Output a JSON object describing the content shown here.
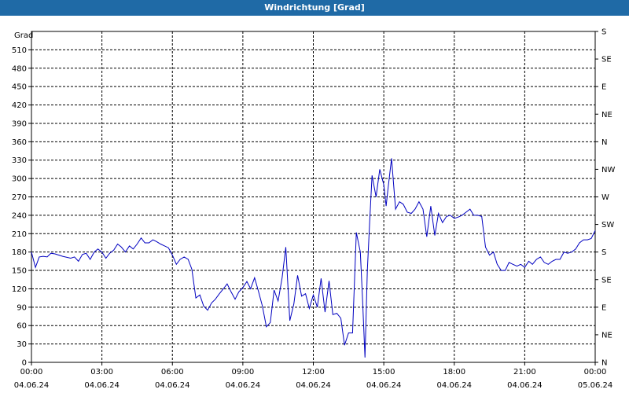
{
  "window": {
    "title": "Windrichtung [Grad]"
  },
  "chart_data": {
    "type": "line",
    "title": "Windrichtung [Grad]",
    "ylabel": "Grad",
    "xlabel": "",
    "ylim": [
      0,
      540
    ],
    "xlim_hours": [
      0,
      24
    ],
    "grid": true,
    "y_ticks": [
      0,
      30,
      60,
      90,
      120,
      150,
      180,
      210,
      240,
      270,
      300,
      330,
      360,
      390,
      420,
      450,
      480,
      510
    ],
    "right_axis_labels": [
      {
        "value": 0,
        "label": "N"
      },
      {
        "value": 45,
        "label": "NE"
      },
      {
        "value": 90,
        "label": "E"
      },
      {
        "value": 135,
        "label": "SE"
      },
      {
        "value": 180,
        "label": "S"
      },
      {
        "value": 225,
        "label": "SW"
      },
      {
        "value": 270,
        "label": "W"
      },
      {
        "value": 315,
        "label": "NW"
      },
      {
        "value": 360,
        "label": "N"
      },
      {
        "value": 405,
        "label": "NE"
      },
      {
        "value": 450,
        "label": "E"
      },
      {
        "value": 495,
        "label": "SE"
      },
      {
        "value": 540,
        "label": "S"
      }
    ],
    "x_ticks": [
      {
        "hour": 0,
        "time": "00:00",
        "date": "04.06.24"
      },
      {
        "hour": 3,
        "time": "03:00",
        "date": "04.06.24"
      },
      {
        "hour": 6,
        "time": "06:00",
        "date": "04.06.24"
      },
      {
        "hour": 9,
        "time": "09:00",
        "date": "04.06.24"
      },
      {
        "hour": 12,
        "time": "12:00",
        "date": "04.06.24"
      },
      {
        "hour": 15,
        "time": "15:00",
        "date": "04.06.24"
      },
      {
        "hour": 18,
        "time": "18:00",
        "date": "04.06.24"
      },
      {
        "hour": 21,
        "time": "21:00",
        "date": "04.06.24"
      },
      {
        "hour": 24,
        "time": "00:00",
        "date": "05.06.24"
      }
    ],
    "series": [
      {
        "color": "#0000c0",
        "points": [
          [
            0.0,
            180
          ],
          [
            0.17,
            155
          ],
          [
            0.33,
            172
          ],
          [
            0.5,
            173
          ],
          [
            0.67,
            172
          ],
          [
            0.83,
            178
          ],
          [
            1.0,
            177
          ],
          [
            1.33,
            173
          ],
          [
            1.67,
            170
          ],
          [
            1.83,
            172
          ],
          [
            2.0,
            165
          ],
          [
            2.17,
            176
          ],
          [
            2.33,
            178
          ],
          [
            2.5,
            168
          ],
          [
            2.67,
            180
          ],
          [
            2.83,
            185
          ],
          [
            3.0,
            180
          ],
          [
            3.17,
            170
          ],
          [
            3.33,
            178
          ],
          [
            3.5,
            183
          ],
          [
            3.67,
            193
          ],
          [
            3.83,
            188
          ],
          [
            4.0,
            180
          ],
          [
            4.17,
            190
          ],
          [
            4.33,
            185
          ],
          [
            4.5,
            193
          ],
          [
            4.67,
            203
          ],
          [
            4.83,
            195
          ],
          [
            5.0,
            195
          ],
          [
            5.17,
            200
          ],
          [
            5.33,
            197
          ],
          [
            5.5,
            193
          ],
          [
            5.67,
            190
          ],
          [
            5.83,
            187
          ],
          [
            6.0,
            175
          ],
          [
            6.17,
            160
          ],
          [
            6.33,
            168
          ],
          [
            6.5,
            172
          ],
          [
            6.67,
            168
          ],
          [
            6.83,
            152
          ],
          [
            7.0,
            105
          ],
          [
            7.17,
            110
          ],
          [
            7.33,
            92
          ],
          [
            7.5,
            85
          ],
          [
            7.67,
            97
          ],
          [
            7.83,
            103
          ],
          [
            8.0,
            112
          ],
          [
            8.17,
            120
          ],
          [
            8.33,
            128
          ],
          [
            8.5,
            115
          ],
          [
            8.67,
            103
          ],
          [
            8.83,
            115
          ],
          [
            9.0,
            122
          ],
          [
            9.17,
            132
          ],
          [
            9.33,
            120
          ],
          [
            9.5,
            138
          ],
          [
            9.67,
            115
          ],
          [
            9.83,
            92
          ],
          [
            10.0,
            58
          ],
          [
            10.17,
            65
          ],
          [
            10.33,
            118
          ],
          [
            10.5,
            100
          ],
          [
            10.67,
            138
          ],
          [
            10.83,
            188
          ],
          [
            11.0,
            68
          ],
          [
            11.17,
            95
          ],
          [
            11.33,
            142
          ],
          [
            11.5,
            108
          ],
          [
            11.67,
            112
          ],
          [
            11.83,
            88
          ],
          [
            12.0,
            110
          ],
          [
            12.17,
            90
          ],
          [
            12.33,
            137
          ],
          [
            12.5,
            82
          ],
          [
            12.67,
            133
          ],
          [
            12.83,
            78
          ],
          [
            13.0,
            80
          ],
          [
            13.17,
            72
          ],
          [
            13.33,
            28
          ],
          [
            13.5,
            48
          ],
          [
            13.67,
            48
          ],
          [
            13.83,
            212
          ],
          [
            14.0,
            180
          ],
          [
            14.1,
            100
          ],
          [
            14.2,
            8
          ],
          [
            14.3,
            150
          ],
          [
            14.4,
            230
          ],
          [
            14.5,
            305
          ],
          [
            14.67,
            270
          ],
          [
            14.83,
            315
          ],
          [
            15.0,
            290
          ],
          [
            15.1,
            255
          ],
          [
            15.17,
            280
          ],
          [
            15.33,
            333
          ],
          [
            15.5,
            250
          ],
          [
            15.67,
            262
          ],
          [
            15.83,
            258
          ],
          [
            16.0,
            245
          ],
          [
            16.17,
            243
          ],
          [
            16.33,
            250
          ],
          [
            16.5,
            262
          ],
          [
            16.67,
            250
          ],
          [
            16.83,
            205
          ],
          [
            17.0,
            255
          ],
          [
            17.17,
            207
          ],
          [
            17.33,
            243
          ],
          [
            17.5,
            228
          ],
          [
            17.67,
            238
          ],
          [
            17.83,
            240
          ],
          [
            18.0,
            235
          ],
          [
            18.17,
            237
          ],
          [
            18.33,
            240
          ],
          [
            18.5,
            245
          ],
          [
            18.67,
            250
          ],
          [
            18.83,
            240
          ],
          [
            19.0,
            240
          ],
          [
            19.17,
            238
          ],
          [
            19.33,
            188
          ],
          [
            19.5,
            175
          ],
          [
            19.67,
            180
          ],
          [
            19.83,
            160
          ],
          [
            20.0,
            150
          ],
          [
            20.17,
            150
          ],
          [
            20.33,
            163
          ],
          [
            20.5,
            160
          ],
          [
            20.67,
            157
          ],
          [
            20.83,
            160
          ],
          [
            21.0,
            155
          ],
          [
            21.17,
            165
          ],
          [
            21.33,
            160
          ],
          [
            21.5,
            168
          ],
          [
            21.67,
            172
          ],
          [
            21.83,
            163
          ],
          [
            22.0,
            160
          ],
          [
            22.17,
            165
          ],
          [
            22.33,
            168
          ],
          [
            22.5,
            168
          ],
          [
            22.67,
            180
          ],
          [
            22.83,
            178
          ],
          [
            23.0,
            180
          ],
          [
            23.17,
            185
          ],
          [
            23.33,
            195
          ],
          [
            23.5,
            200
          ],
          [
            23.67,
            200
          ],
          [
            23.83,
            202
          ],
          [
            24.0,
            215
          ]
        ]
      }
    ]
  }
}
